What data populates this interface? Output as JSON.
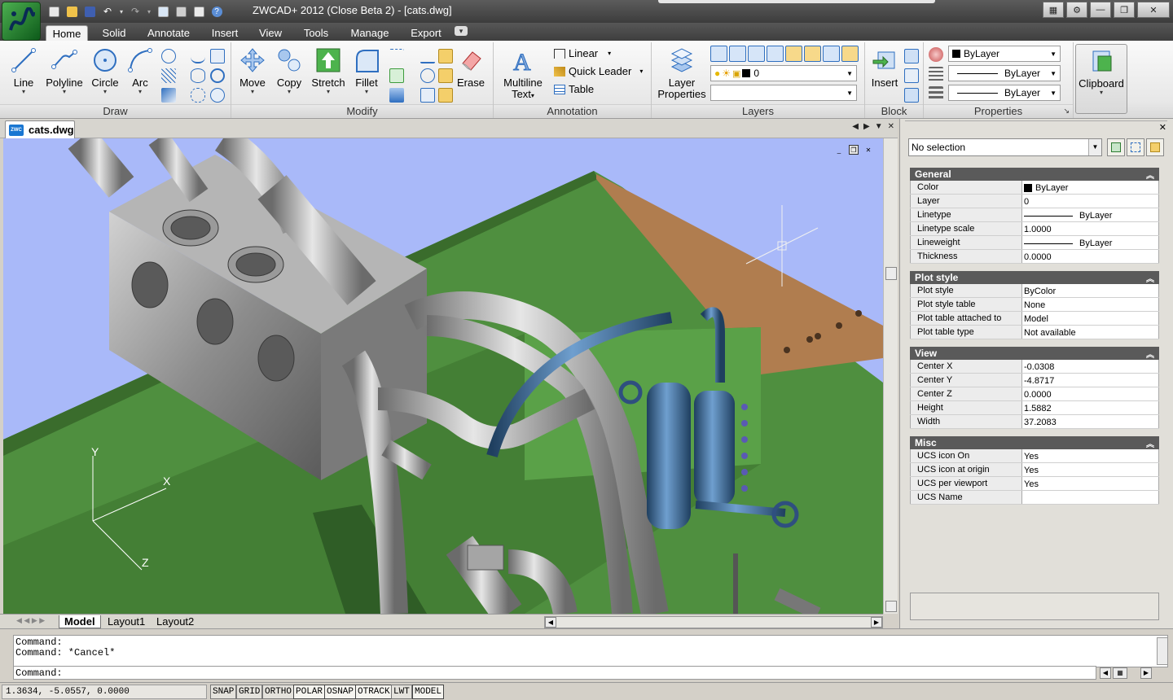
{
  "window": {
    "title": "ZWCAD+ 2012 (Close Beta 2) - [cats.dwg]"
  },
  "ribbon": {
    "tabs": [
      "Home",
      "Solid",
      "Annotate",
      "Insert",
      "View",
      "Tools",
      "Manage",
      "Export"
    ],
    "active_tab": "Home",
    "draw": {
      "label": "Draw",
      "line": "Line",
      "polyline": "Polyline",
      "circle": "Circle",
      "arc": "Arc"
    },
    "modify": {
      "label": "Modify",
      "move": "Move",
      "copy": "Copy",
      "stretch": "Stretch",
      "fillet": "Fillet",
      "erase": "Erase"
    },
    "annotation": {
      "label": "Annotation",
      "mtext_line1": "Multiline",
      "mtext_line2": "Text",
      "linear": "Linear",
      "quick_leader": "Quick Leader",
      "table": "Table"
    },
    "layers": {
      "label": "Layers",
      "layer_props_line1": "Layer",
      "layer_props_line2": "Properties",
      "current_layer": "0"
    },
    "block": {
      "label": "Block",
      "insert": "Insert"
    },
    "properties": {
      "label": "Properties",
      "color": "ByLayer",
      "linetype": "ByLayer",
      "lineweight": "ByLayer"
    },
    "clipboard": {
      "label": "Clipboard"
    }
  },
  "document": {
    "tab": "cats.dwg",
    "layouts": [
      "Model",
      "Layout1",
      "Layout2"
    ],
    "active_layout": "Model"
  },
  "ucs": {
    "x": "X",
    "y": "Y",
    "z": "Z"
  },
  "properties_palette": {
    "selection": "No selection",
    "sections": {
      "general": {
        "title": "General",
        "rows": [
          {
            "k": "Color",
            "v": "ByLayer"
          },
          {
            "k": "Layer",
            "v": "0"
          },
          {
            "k": "Linetype",
            "v": "ByLayer"
          },
          {
            "k": "Linetype scale",
            "v": "1.0000"
          },
          {
            "k": "Lineweight",
            "v": "ByLayer"
          },
          {
            "k": "Thickness",
            "v": "0.0000"
          }
        ]
      },
      "plot": {
        "title": "Plot style",
        "rows": [
          {
            "k": "Plot style",
            "v": "ByColor"
          },
          {
            "k": "Plot style table",
            "v": "None"
          },
          {
            "k": "Plot table attached to",
            "v": "Model"
          },
          {
            "k": "Plot table type",
            "v": "Not available"
          }
        ]
      },
      "view": {
        "title": "View",
        "rows": [
          {
            "k": "Center X",
            "v": "-0.0308"
          },
          {
            "k": "Center Y",
            "v": "-4.8717"
          },
          {
            "k": "Center Z",
            "v": "0.0000"
          },
          {
            "k": "Height",
            "v": "1.5882"
          },
          {
            "k": "Width",
            "v": "37.2083"
          }
        ]
      },
      "misc": {
        "title": "Misc",
        "rows": [
          {
            "k": "UCS icon On",
            "v": "Yes"
          },
          {
            "k": "UCS icon at origin",
            "v": "Yes"
          },
          {
            "k": "UCS per viewport",
            "v": "Yes"
          },
          {
            "k": "UCS Name",
            "v": ""
          }
        ]
      }
    }
  },
  "command": {
    "history": [
      "Command:",
      "Command: *Cancel*"
    ],
    "prompt": "Command:"
  },
  "status": {
    "coords": "1.3634,  -5.0557, 0.0000",
    "buttons": [
      "SNAP",
      "GRID",
      "ORTHO",
      "POLAR",
      "OSNAP",
      "OTRACK",
      "LWT",
      "MODEL"
    ],
    "on": [
      "POLAR",
      "OSNAP",
      "OTRACK",
      "MODEL"
    ]
  },
  "colors": {
    "viewport_bg": "#a9b9f9",
    "plane_green": "#4f8f3f",
    "steel": "#9a9a9a",
    "pipe_blue": "#3f6f9f"
  }
}
